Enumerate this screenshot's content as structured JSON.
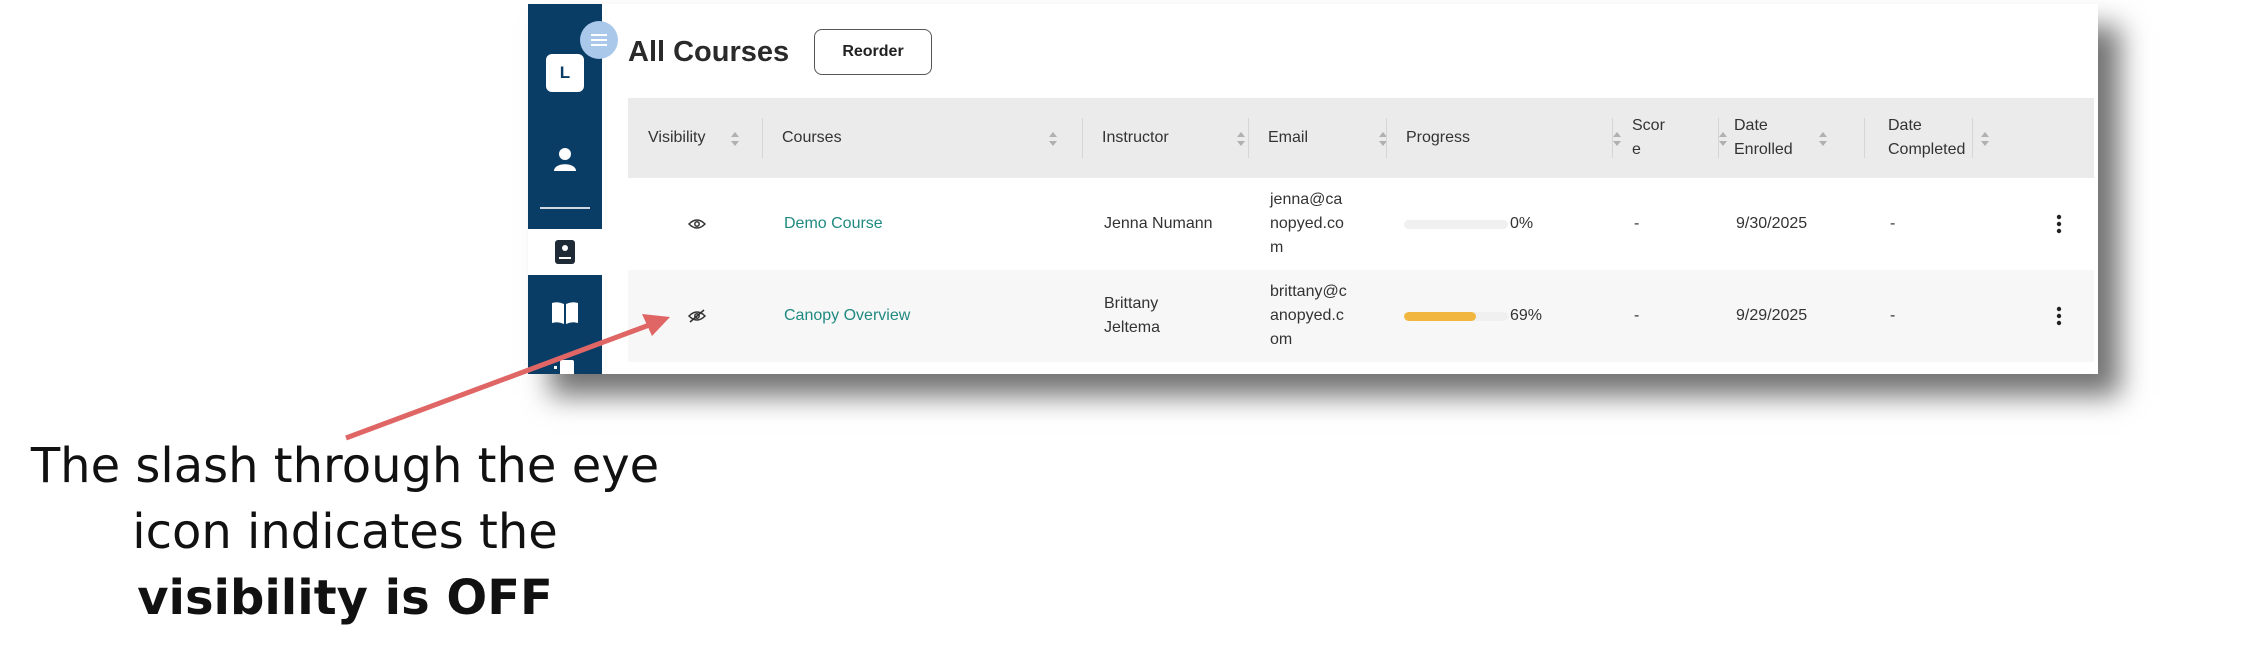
{
  "sidebar": {
    "badge_letter": "L",
    "icons": [
      "user-icon",
      "course-icon",
      "book-icon",
      "document-icon"
    ]
  },
  "header": {
    "title": "All Courses",
    "reorder_label": "Reorder"
  },
  "table": {
    "columns": [
      "Visibility",
      "Courses",
      "Instructor",
      "Email",
      "Progress",
      "Scor\ne",
      "Date\nEnrolled",
      "Date\nCompleted"
    ],
    "rows": [
      {
        "visibility": "on",
        "course": "Demo Course",
        "instructor": "Jenna Numann",
        "email": "jenna@ca\nnopyed.co\nm",
        "progress": 0,
        "progress_label": "0%",
        "score": "-",
        "date_enrolled": "9/30/2025",
        "date_completed": "-"
      },
      {
        "visibility": "off",
        "course": "Canopy Overview",
        "instructor": "Brittany\nJeltema",
        "email": "brittany@c\nanopyed.c\nom",
        "progress": 69,
        "progress_label": "69%",
        "score": "-",
        "date_enrolled": "9/29/2025",
        "date_completed": "-"
      }
    ]
  },
  "annotation": {
    "line1": "The slash through the eye",
    "line2": "icon indicates the",
    "line3": "visibility is OFF"
  },
  "colors": {
    "sidebar": "#0a3d66",
    "link": "#1f8a80",
    "progress": "#f0b63f",
    "arrow": "#e06666"
  }
}
